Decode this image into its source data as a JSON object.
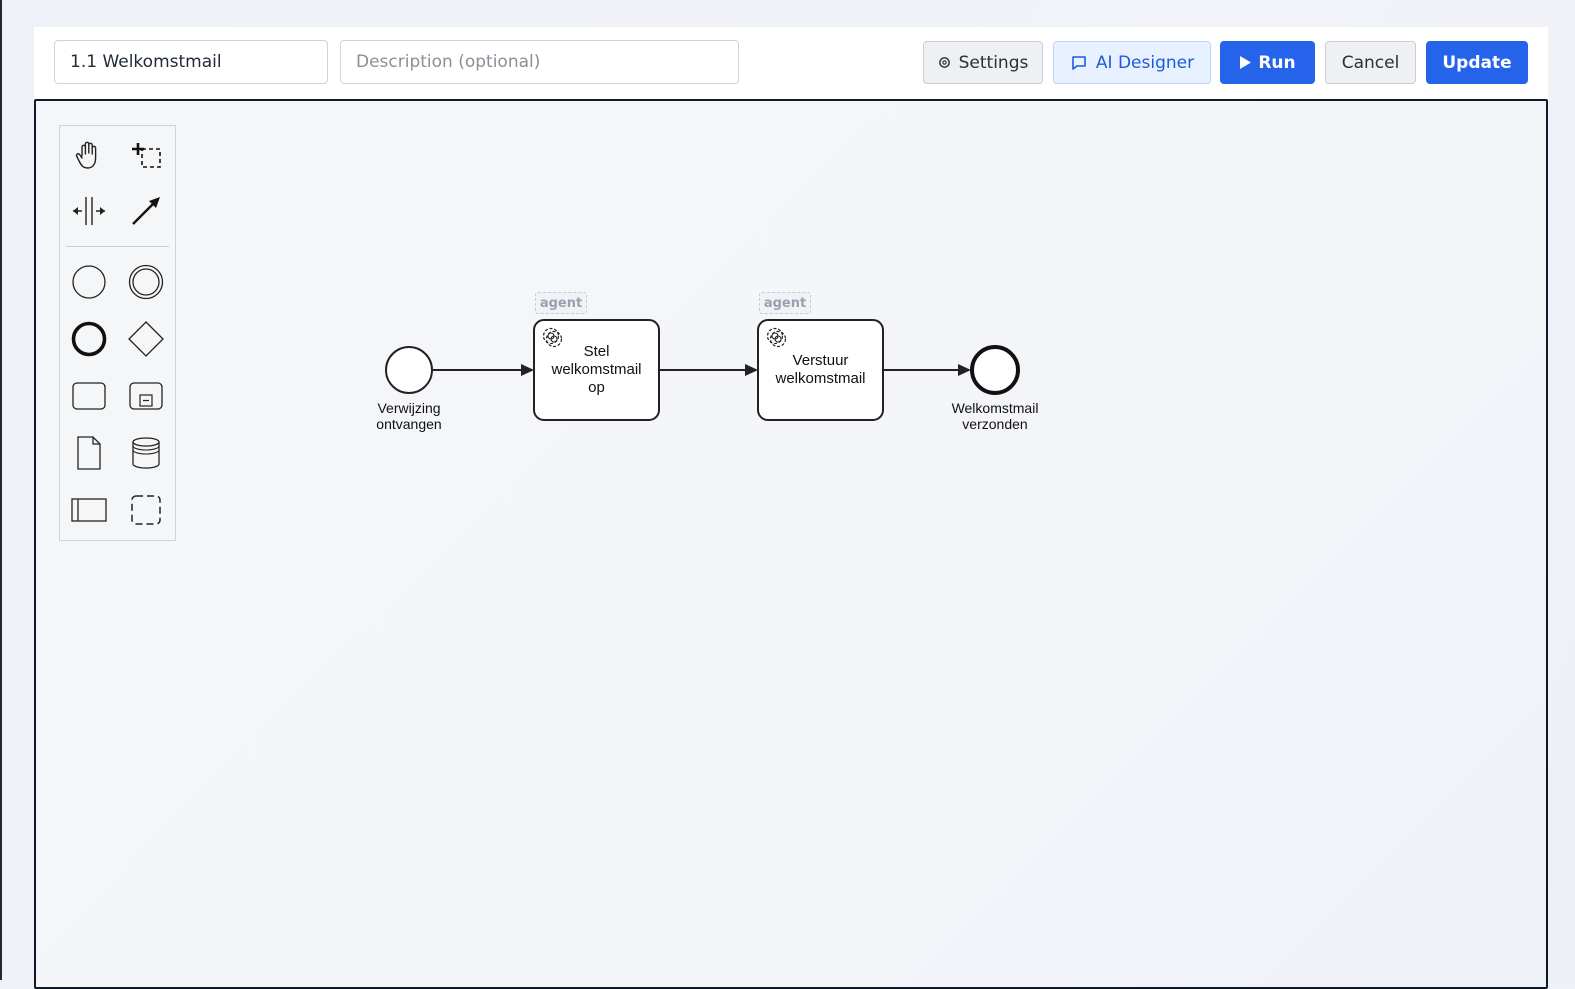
{
  "toolbar": {
    "name_value": "1.1 Welkomstmail",
    "description_placeholder": "Description (optional)",
    "settings_label": "Settings",
    "ai_designer_label": "AI Designer",
    "run_label": "Run",
    "cancel_label": "Cancel",
    "update_label": "Update",
    "accent_color": "#2563eb"
  },
  "palette": {
    "tools": [
      {
        "name": "hand-tool",
        "icon": "hand-icon"
      },
      {
        "name": "lasso-tool",
        "icon": "lasso-icon"
      },
      {
        "name": "space-tool",
        "icon": "space-icon"
      },
      {
        "name": "connect-tool",
        "icon": "connect-arrow-icon"
      },
      {
        "name": "start-event",
        "icon": "start-event-icon"
      },
      {
        "name": "intermediate-event",
        "icon": "intermediate-event-icon"
      },
      {
        "name": "end-event",
        "icon": "end-event-icon"
      },
      {
        "name": "gateway",
        "icon": "gateway-icon"
      },
      {
        "name": "task",
        "icon": "task-icon"
      },
      {
        "name": "subprocess",
        "icon": "subprocess-icon"
      },
      {
        "name": "data-object",
        "icon": "data-object-icon"
      },
      {
        "name": "data-store",
        "icon": "data-store-icon"
      },
      {
        "name": "pool",
        "icon": "pool-icon"
      },
      {
        "name": "group",
        "icon": "group-icon"
      }
    ]
  },
  "diagram": {
    "start_event": {
      "label_line1": "Verwijzing",
      "label_line2": "ontvangen"
    },
    "task1": {
      "tag": "agent",
      "label_line1": "Stel",
      "label_line2": "welkomstmail",
      "label_line3": "op"
    },
    "task2": {
      "tag": "agent",
      "label_line1": "Verstuur",
      "label_line2": "welkomstmail"
    },
    "end_event": {
      "label_line1": "Welkomstmail",
      "label_line2": "verzonden"
    }
  }
}
